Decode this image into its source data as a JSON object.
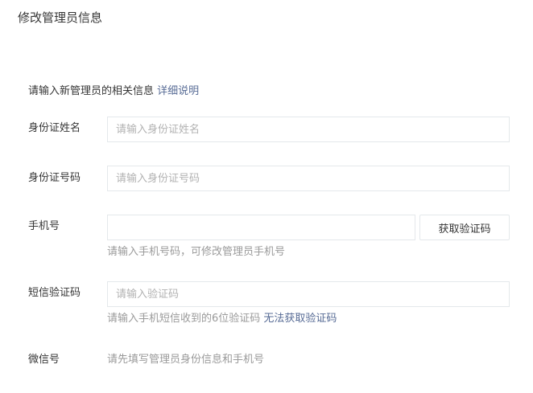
{
  "page": {
    "title": "修改管理员信息"
  },
  "intro": {
    "text": "请输入新管理员的相关信息",
    "link_label": "详细说明"
  },
  "form": {
    "id_name": {
      "label": "身份证姓名",
      "value": "",
      "placeholder": "请输入身份证姓名"
    },
    "id_number": {
      "label": "身份证号码",
      "value": "",
      "placeholder": "请输入身份证号码"
    },
    "phone": {
      "label": "手机号",
      "value": "",
      "placeholder": "",
      "button_label": "获取验证码",
      "hint": "请输入手机号码，可修改管理员手机号"
    },
    "sms_code": {
      "label": "短信验证码",
      "value": "",
      "placeholder": "请输入验证码",
      "hint": "请输入手机短信收到的6位验证码",
      "hint_link": "无法获取验证码"
    },
    "wechat": {
      "label": "微信号",
      "hint": "请先填写管理员身份信息和手机号"
    }
  },
  "colors": {
    "link": "#576b95",
    "text": "#353535",
    "hint": "#9a9a9a",
    "border": "#e4e8eb"
  }
}
